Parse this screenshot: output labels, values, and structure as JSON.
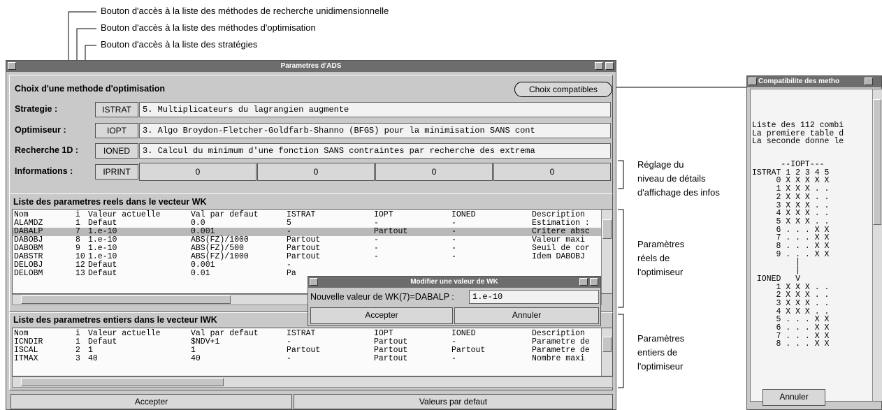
{
  "annotations": {
    "top": [
      "Bouton d'accès à la liste des méthodes de recherche unidimensionnelle",
      "Bouton d'accès à la liste des méthodes d'optimisation",
      "Bouton d'accès à la liste des stratégies"
    ],
    "right_info": [
      "Réglage du",
      "niveau de détails",
      "d'affichage des infos"
    ],
    "right_reals": [
      "Paramètres",
      "réels de",
      "l'optimiseur"
    ],
    "right_ints": [
      "Paramètres",
      "entiers de",
      "l'optimiseur"
    ]
  },
  "main_window": {
    "title": "Parametres d'ADS",
    "section_title": "Choix d'une methode d'optimisation",
    "choix_button": "Choix compatibles",
    "strategie": {
      "label": "Strategie :",
      "button": "ISTRAT",
      "value": "5. Multiplicateurs du lagrangien augmente"
    },
    "optimiseur": {
      "label": "Optimiseur :",
      "button": "IOPT",
      "value": "3. Algo Broydon-Fletcher-Goldfarb-Shanno (BFGS) pour la minimisation SANS cont"
    },
    "recherche": {
      "label": "Recherche 1D :",
      "button": "IONED",
      "value": "3. Calcul du minimum d'une fonction SANS contraintes par recherche des extrema"
    },
    "informations": {
      "label": "Informations :",
      "button": "IPRINT",
      "values": [
        "0",
        "0",
        "0",
        "0"
      ]
    },
    "reals": {
      "title": "Liste des parametres reels dans le vecteur WK",
      "header": [
        "Nom",
        "i",
        "Valeur actuelle",
        "Val par defaut",
        "ISTRAT",
        "IOPT",
        "IONED",
        "Description"
      ],
      "rows": [
        [
          "ALAMDZ",
          "1",
          "Defaut",
          "0.0",
          "5",
          "-",
          "-",
          "Estimation :"
        ],
        [
          "DABALP",
          "7",
          "1.e-10",
          "0.001",
          "-",
          "Partout",
          "-",
          "Critere absc"
        ],
        [
          "DABOBJ",
          "8",
          "1.e-10",
          "ABS(FZ)/1000",
          "Partout",
          "-",
          "-",
          "Valeur maxi"
        ],
        [
          "DABOBM",
          "9",
          "1.e-10",
          "ABS(FZ)/500",
          "Partout",
          "-",
          "-",
          "Seuil de cor"
        ],
        [
          "DABSTR",
          "10",
          "1.e-10",
          "ABS(FZ)/1000",
          "Partout",
          "-",
          "-",
          "Idem DABOBJ"
        ],
        [
          "DELOBJ",
          "12",
          "Defaut",
          "0.001",
          "-",
          "",
          "",
          ""
        ],
        [
          "DELOBM",
          "13",
          "Defaut",
          "0.01",
          "Pa",
          "",
          "",
          ""
        ]
      ]
    },
    "ints": {
      "title": "Liste des parametres entiers dans le vecteur IWK",
      "header": [
        "Nom",
        "i",
        "Valeur actuelle",
        "Val par defaut",
        "ISTRAT",
        "IOPT",
        "IONED",
        "Description"
      ],
      "rows": [
        [
          "ICNDIR",
          "1",
          "Defaut",
          "$NDV+1",
          "-",
          "Partout",
          "-",
          "Parametre de"
        ],
        [
          "ISCAL",
          "2",
          "1",
          "1",
          "Partout",
          "Partout",
          "Partout",
          "Parametre de"
        ],
        [
          "ITMAX",
          "3",
          "40",
          "40",
          "-",
          "Partout",
          "-",
          "Nombre maxi"
        ]
      ]
    },
    "accept_button": "Accepter",
    "defaults_button": "Valeurs par defaut"
  },
  "dialog": {
    "title": "Modifier une valeur de WK",
    "label": "Nouvelle valeur de WK(7)=DABALP :",
    "value": "1.e-10",
    "accept": "Accepter",
    "cancel": "Annuler"
  },
  "compat_window": {
    "title": "Compatibilite des metho",
    "lines": [
      "Liste des 112 combi",
      "La premiere table d",
      "La seconde donne le"
    ],
    "table1_header": [
      "      --IOPT---",
      "ISTRAT 1 2 3 4 5"
    ],
    "table1_rows": [
      "     0 X X X X X",
      "     1 X X X . .",
      "     2 X X X . .",
      "     3 X X X . .",
      "     4 X X X . .",
      "     5 X X X . .",
      "     6 . . . X X",
      "     7 . . . X X",
      "     8 . . . X X",
      "     9 . . . X X"
    ],
    "arrow_mid": [
      "         |",
      "         |",
      " IONED   V"
    ],
    "table2_rows": [
      "     1 X X X . .",
      "     2 X X X . .",
      "     3 X X X . .",
      "     4 X X X . .",
      "     5 . . . X X",
      "     6 . . . X X",
      "     7 . . . X X",
      "     8 . . . X X"
    ],
    "cancel": "Annuler"
  }
}
